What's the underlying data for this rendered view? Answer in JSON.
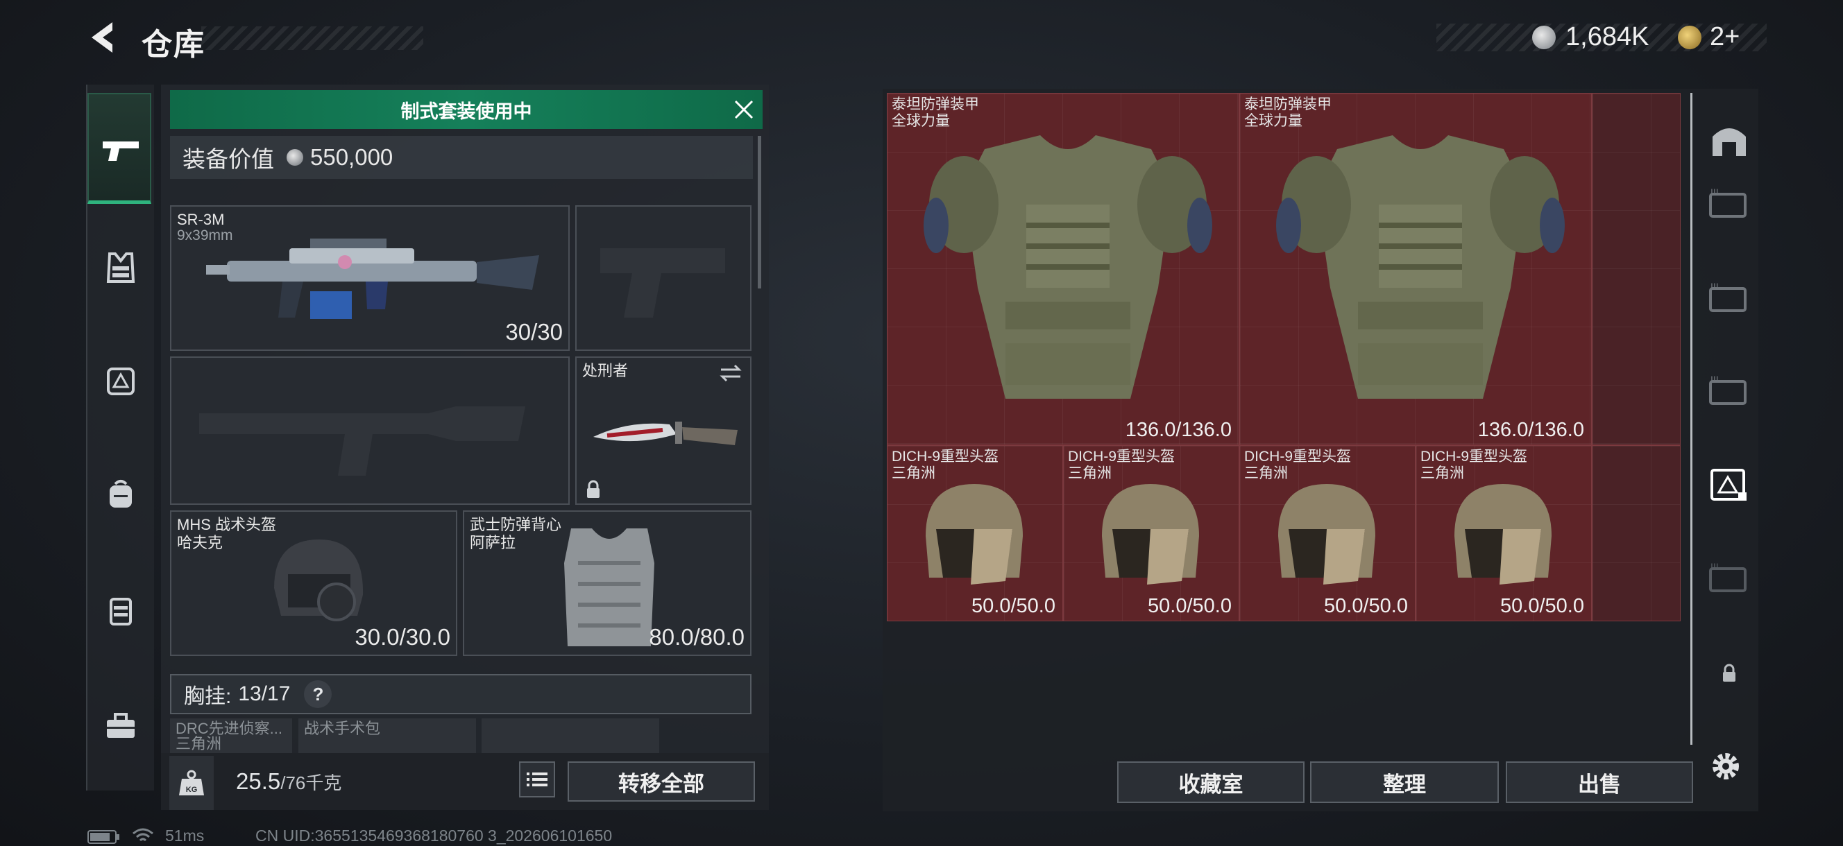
{
  "header": {
    "title": "仓库",
    "currency_primary": "1,684K",
    "currency_secondary": "2+"
  },
  "left_nav": {
    "items": [
      {
        "name": "weapons",
        "icon": "pistol-icon",
        "active": true
      },
      {
        "name": "armor",
        "icon": "vest-icon",
        "active": false
      },
      {
        "name": "chest-rig",
        "icon": "chest-rig-icon",
        "active": false
      },
      {
        "name": "backpack",
        "icon": "backpack-icon",
        "active": false
      },
      {
        "name": "pouch",
        "icon": "pouch-icon",
        "active": false
      },
      {
        "name": "toolbox",
        "icon": "toolbox-icon",
        "active": false
      }
    ]
  },
  "loadout": {
    "banner": "制式套装使用中",
    "value_label": "装备价值",
    "value": "550,000",
    "primary": {
      "name": "SR-3M",
      "caliber": "9x39mm",
      "ammo": "30/30"
    },
    "melee": {
      "name": "处刑者"
    },
    "helmet": {
      "name": "MHS 战术头盔",
      "sub": "哈夫克",
      "durability": "30.0/30.0"
    },
    "armor": {
      "name": "武士防弹背心",
      "sub": "阿萨拉",
      "durability": "80.0/80.0"
    },
    "chest_rig_label": "胸挂:",
    "chest_rig_value": "13/17",
    "chest_rig_help": "?",
    "chest_items": [
      {
        "name": "DRC先进侦察...",
        "sub": "三角洲"
      },
      {
        "name": "战术手术包",
        "sub": ""
      }
    ],
    "weight_value": "25.5",
    "weight_max": "/76千克",
    "transfer_all": "转移全部",
    "kg_label": "KG"
  },
  "stash": {
    "items": [
      {
        "name": "泰坦防弹装甲",
        "sub": "全球力量",
        "durability": "136.0/136.0"
      },
      {
        "name": "泰坦防弹装甲",
        "sub": "全球力量",
        "durability": "136.0/136.0"
      },
      {
        "name": "DICH-9重型头盔",
        "sub": "三角洲",
        "durability": "50.0/50.0"
      },
      {
        "name": "DICH-9重型头盔",
        "sub": "三角洲",
        "durability": "50.0/50.0"
      },
      {
        "name": "DICH-9重型头盔",
        "sub": "三角洲",
        "durability": "50.0/50.0"
      },
      {
        "name": "DICH-9重型头盔",
        "sub": "三角洲",
        "durability": "50.0/50.0"
      }
    ],
    "buttons": {
      "collection": "收藏室",
      "organize": "整理",
      "sell": "出售"
    }
  },
  "status_bar": {
    "ping": "51ms",
    "uid": "CN UID:3655135469368180760 3_202606101650"
  },
  "colors": {
    "accent_green": "#15805a",
    "cell_red": "#5e2428",
    "active_tab_border": "#2fb37e"
  }
}
